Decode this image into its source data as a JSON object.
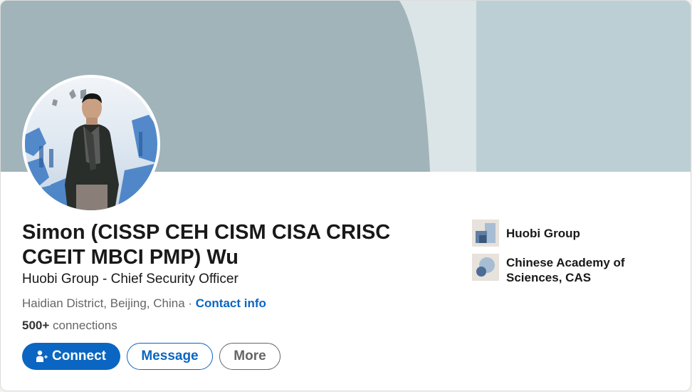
{
  "profile": {
    "name": "Simon (CISSP CEH CISM CISA CRISC CGEIT MBCI PMP) Wu",
    "headline": "Huobi Group - Chief Security Officer",
    "location": "Haidian District, Beijing, China",
    "separator": " · ",
    "contact_info": "Contact info",
    "connections_count": "500+",
    "connections_label": " connections"
  },
  "actions": {
    "connect_label": "Connect",
    "message_label": "Message",
    "more_label": "More"
  },
  "organizations": [
    {
      "label": "Huobi Group",
      "icon": "company-logo-icon"
    },
    {
      "label": "Chinese Academy of Sciences, CAS",
      "icon": "school-logo-icon"
    }
  ],
  "colors": {
    "accent": "#0a66c2",
    "banner_primary": "#a0b4b9",
    "banner_light": "#dbe5e7",
    "banner_secondary": "#bccfd4"
  }
}
